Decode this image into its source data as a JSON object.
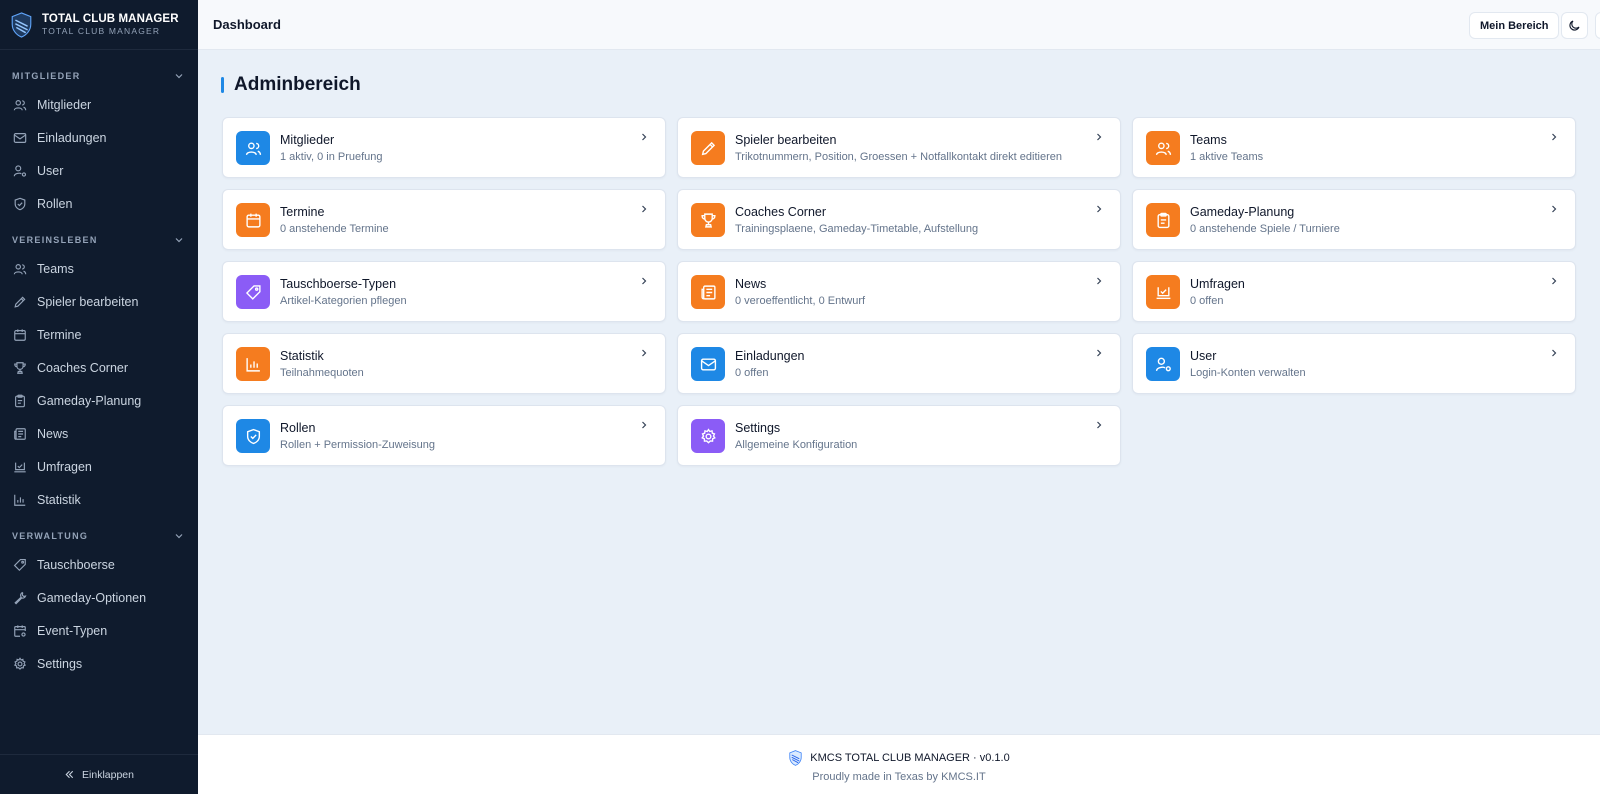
{
  "brand": {
    "title": "TOTAL CLUB MANAGER",
    "subtitle": "TOTAL CLUB MANAGER"
  },
  "sidebar": {
    "sections": [
      {
        "label": "MITGLIEDER"
      },
      {
        "label": "VEREINSLEBEN"
      },
      {
        "label": "VERWALTUNG"
      }
    ],
    "items": [
      {
        "label": "Mitglieder",
        "icon": "users-icon"
      },
      {
        "label": "Einladungen",
        "icon": "mail-icon"
      },
      {
        "label": "User",
        "icon": "user-gear-icon"
      },
      {
        "label": "Rollen",
        "icon": "shield-icon"
      },
      {
        "label": "Teams",
        "icon": "users-icon"
      },
      {
        "label": "Spieler bearbeiten",
        "icon": "pencil-icon"
      },
      {
        "label": "Termine",
        "icon": "calendar-icon"
      },
      {
        "label": "Coaches Corner",
        "icon": "trophy-icon"
      },
      {
        "label": "Gameday-Planung",
        "icon": "clipboard-icon"
      },
      {
        "label": "News",
        "icon": "newspaper-icon"
      },
      {
        "label": "Umfragen",
        "icon": "poll-icon"
      },
      {
        "label": "Statistik",
        "icon": "bar-chart-icon"
      },
      {
        "label": "Tauschboerse",
        "icon": "tag-icon"
      },
      {
        "label": "Gameday-Optionen",
        "icon": "wrench-icon"
      },
      {
        "label": "Event-Typen",
        "icon": "calendar-cog-icon"
      },
      {
        "label": "Settings",
        "icon": "gear-icon"
      }
    ],
    "collapse_label": "Einklappen"
  },
  "topbar": {
    "title": "Dashboard",
    "area_button": "Mein Bereich"
  },
  "main": {
    "heading": "Adminbereich",
    "cards": [
      {
        "title": "Mitglieder",
        "subtitle": "1 aktiv, 0 in Pruefung",
        "icon": "users-icon",
        "color": "#1e88e5"
      },
      {
        "title": "Spieler bearbeiten",
        "subtitle": "Trikotnummern, Position, Groessen + Notfallkontakt direkt editieren",
        "icon": "pencil-icon",
        "color": "#f57c1f"
      },
      {
        "title": "Teams",
        "subtitle": "1 aktive Teams",
        "icon": "users-icon",
        "color": "#f57c1f"
      },
      {
        "title": "Termine",
        "subtitle": "0 anstehende Termine",
        "icon": "calendar-icon",
        "color": "#f57c1f"
      },
      {
        "title": "Coaches Corner",
        "subtitle": "Trainingsplaene, Gameday-Timetable, Aufstellung",
        "icon": "trophy-icon",
        "color": "#f57c1f"
      },
      {
        "title": "Gameday-Planung",
        "subtitle": "0 anstehende Spiele / Turniere",
        "icon": "clipboard-icon",
        "color": "#f57c1f"
      },
      {
        "title": "Tauschboerse-Typen",
        "subtitle": "Artikel-Kategorien pflegen",
        "icon": "tag-icon",
        "color": "#8b5cf6"
      },
      {
        "title": "News",
        "subtitle": "0 veroeffentlicht, 0 Entwurf",
        "icon": "newspaper-icon",
        "color": "#f57c1f"
      },
      {
        "title": "Umfragen",
        "subtitle": "0 offen",
        "icon": "poll-icon",
        "color": "#f57c1f"
      },
      {
        "title": "Statistik",
        "subtitle": "Teilnahmequoten",
        "icon": "bar-chart-icon",
        "color": "#f57c1f"
      },
      {
        "title": "Einladungen",
        "subtitle": "0 offen",
        "icon": "mail-icon",
        "color": "#1e88e5"
      },
      {
        "title": "User",
        "subtitle": "Login-Konten verwalten",
        "icon": "user-gear-icon",
        "color": "#1e88e5"
      },
      {
        "title": "Rollen",
        "subtitle": "Rollen + Permission-Zuweisung",
        "icon": "shield-icon",
        "color": "#1e88e5"
      },
      {
        "title": "Settings",
        "subtitle": "Allgemeine Konfiguration",
        "icon": "gear-icon",
        "color": "#8b5cf6"
      }
    ]
  },
  "footer": {
    "line1": "KMCS TOTAL CLUB MANAGER · v0.1.0",
    "line2": "Proudly made in Texas by KMCS.IT"
  }
}
